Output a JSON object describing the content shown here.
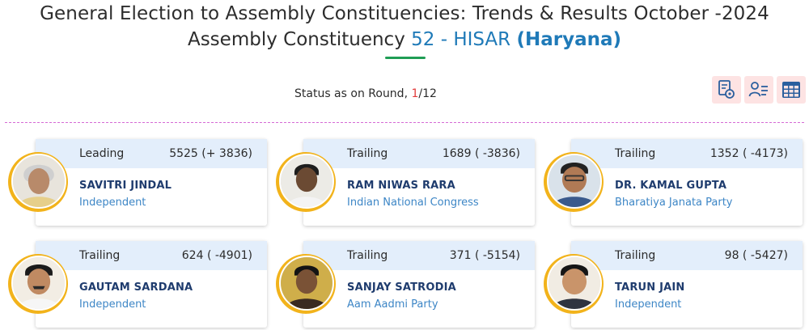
{
  "header": {
    "title_line1": "General Election to Assembly Constituencies: Trends & Results October -2024",
    "title_line2_prefix": "Assembly Constituency",
    "constituency": "52 - HISAR",
    "state": "(Haryana)"
  },
  "status": {
    "label": "Status as on Round,",
    "current_round": "1",
    "total_rounds": "/12"
  },
  "toolbar": {
    "buttons": [
      {
        "icon": "report-settings-icon"
      },
      {
        "icon": "user-list-icon"
      },
      {
        "icon": "table-grid-icon"
      }
    ]
  },
  "colors": {
    "accent_blue": "#1f7ab8",
    "underline_green": "#1f9d55",
    "round_red": "#e23b3b",
    "card_header": "#e3eefb",
    "ring_gold": "#f2b31b",
    "divider_magenta": "#d56ad5"
  },
  "candidates": [
    {
      "status": "Leading",
      "votes": "5525 (+ 3836)",
      "name": "SAVITRI JINDAL",
      "party": "Independent"
    },
    {
      "status": "Trailing",
      "votes": "1689 ( -3836)",
      "name": "RAM NIWAS RARA",
      "party": "Indian National Congress"
    },
    {
      "status": "Trailing",
      "votes": "1352 ( -4173)",
      "name": "DR. KAMAL GUPTA",
      "party": "Bharatiya Janata Party"
    },
    {
      "status": "Trailing",
      "votes": "624 ( -4901)",
      "name": "GAUTAM SARDANA",
      "party": "Independent"
    },
    {
      "status": "Trailing",
      "votes": "371 ( -5154)",
      "name": "SANJAY SATRODIA",
      "party": "Aam Aadmi Party"
    },
    {
      "status": "Trailing",
      "votes": "98 ( -5427)",
      "name": "TARUN JAIN",
      "party": "Independent"
    }
  ]
}
